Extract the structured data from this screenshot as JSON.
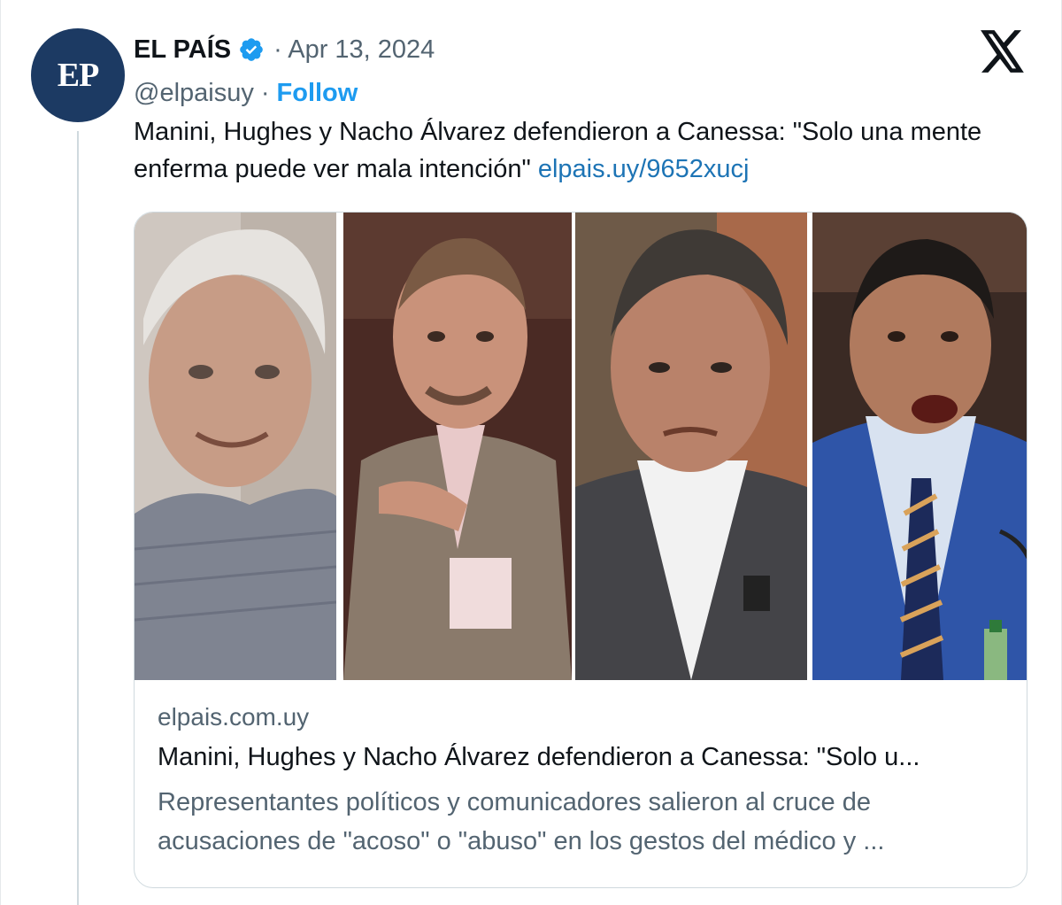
{
  "tweet": {
    "avatar_text": "EP",
    "display_name": "EL PAÍS",
    "date": "· Apr 13, 2024",
    "handle": "@elpaisuy",
    "separator": "·",
    "follow_label": "Follow",
    "text": "Manini, Hughes y Nacho Álvarez defendieron a Canessa: \"Solo una mente enferma puede ver mala intención\" ",
    "link": "elpais.uy/9652xucj"
  },
  "card": {
    "domain": "elpais.com.uy",
    "title": "Manini, Hughes y Nacho Álvarez defendieron a Canessa: \"Solo u...",
    "description": "Representantes políticos y comunicadores salieron al cruce de acusaciones de \"acoso\" o \"abuso\" en los gestos del médico y ...",
    "photos": [
      "portrait-elderly-man",
      "portrait-man-pointing",
      "portrait-man-white-shirt",
      "portrait-man-speaking-microphone"
    ]
  },
  "icons": [
    "verified-badge-icon",
    "x-logo-icon"
  ],
  "colors": {
    "accent": "#1d9bf0",
    "link": "#1d74b5",
    "secondary_text": "#536471",
    "avatar_bg": "#1c3a63"
  }
}
